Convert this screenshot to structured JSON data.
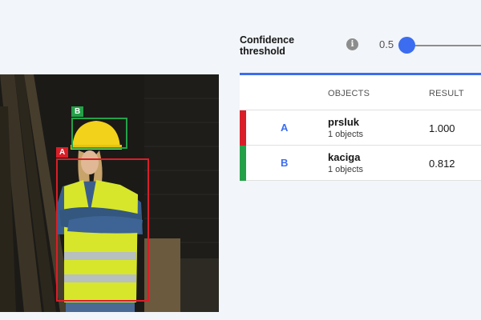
{
  "threshold": {
    "label": "Confidence threshold",
    "value": "0.5",
    "level": 0.5,
    "info_icon": "info-icon"
  },
  "table": {
    "headers": {
      "objects": "OBJECTS",
      "result": "RESULT"
    },
    "rows": [
      {
        "letter": "A",
        "name": "prsluk",
        "count": "1 objects",
        "result": "1.000",
        "color": "#da1e28"
      },
      {
        "letter": "B",
        "name": "kaciga",
        "count": "1 objects",
        "result": "0.812",
        "color": "#24a148"
      }
    ]
  },
  "detections": [
    {
      "letter": "A",
      "color": "#da1e28"
    },
    {
      "letter": "B",
      "color": "#24a148"
    }
  ],
  "colors": {
    "accent": "#3c6df0",
    "background": "#f2f5f9"
  }
}
